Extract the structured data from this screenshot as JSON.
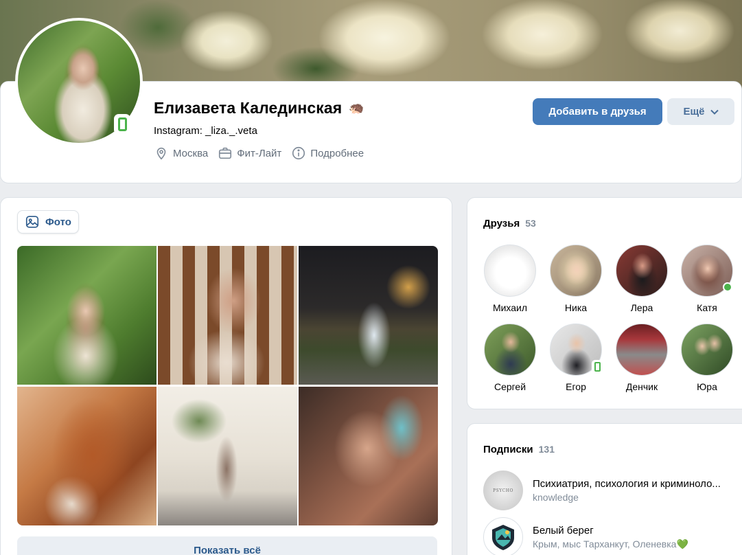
{
  "profile": {
    "name": "Елизавета Калединская",
    "name_emoji": "🦔",
    "status": "Instagram: _liza._.veta",
    "city": "Москва",
    "work": "Фит-Лайт",
    "more_info": "Подробнее",
    "add_friend_label": "Добавить в друзья",
    "more_label": "Ещё"
  },
  "photos": {
    "tab_label": "Фото",
    "show_all_label": "Показать всё"
  },
  "friends": {
    "title": "Друзья",
    "count": "53",
    "items": [
      {
        "name": "Михаил"
      },
      {
        "name": "Ника"
      },
      {
        "name": "Лера"
      },
      {
        "name": "Катя"
      },
      {
        "name": "Сергей"
      },
      {
        "name": "Егор"
      },
      {
        "name": "Денчик"
      },
      {
        "name": "Юра"
      }
    ]
  },
  "subscriptions": {
    "title": "Подписки",
    "count": "131",
    "items": [
      {
        "title": "Психиатрия, психология и криминоло...",
        "desc": "knowledge",
        "avatar_text": "PSYCHO"
      },
      {
        "title": "Белый берег",
        "desc": "Крым, мыс Тарханкут, Оленевка",
        "heart": "💚"
      }
    ]
  },
  "colors": {
    "accent": "#447bba",
    "link": "#2c5a8c",
    "online": "#4bb34b"
  }
}
